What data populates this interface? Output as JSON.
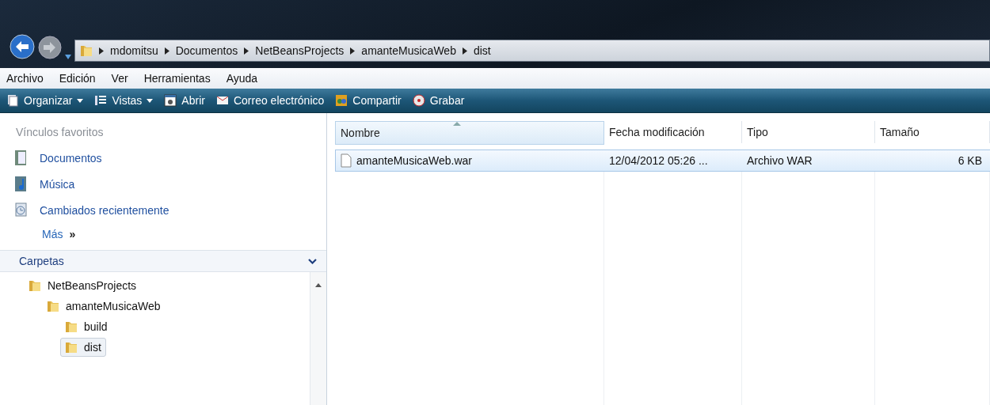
{
  "address_bar": {
    "crumbs": [
      "mdomitsu",
      "Documentos",
      "NetBeansProjects",
      "amanteMusicaWeb",
      "dist"
    ]
  },
  "menu_bar": [
    "Archivo",
    "Edición",
    "Ver",
    "Herramientas",
    "Ayuda"
  ],
  "toolbar": [
    {
      "label": "Organizar",
      "kind": "organize",
      "dropdown": true
    },
    {
      "label": "Vistas",
      "kind": "views",
      "dropdown": true
    },
    {
      "label": "Abrir",
      "kind": "open",
      "dropdown": false
    },
    {
      "label": "Correo electrónico",
      "kind": "mail",
      "dropdown": false
    },
    {
      "label": "Compartir",
      "kind": "share",
      "dropdown": false
    },
    {
      "label": "Grabar",
      "kind": "burn",
      "dropdown": false
    }
  ],
  "sidebar": {
    "title": "Vínculos favoritos",
    "links": [
      {
        "label": "Documentos",
        "kind": "documents"
      },
      {
        "label": "Música",
        "kind": "music"
      },
      {
        "label": "Cambiados recientemente",
        "kind": "recent"
      }
    ],
    "more": {
      "label": "Más",
      "chevrons": "»"
    },
    "folders_title": "Carpetas",
    "tree": [
      {
        "label": "NetBeansProjects",
        "selected": false,
        "children": [
          {
            "label": "amanteMusicaWeb",
            "selected": false,
            "children": [
              {
                "label": "build",
                "selected": false
              },
              {
                "label": "dist",
                "selected": true
              }
            ]
          }
        ]
      }
    ]
  },
  "file_list": {
    "columns": [
      {
        "label": "Nombre",
        "sorted": true
      },
      {
        "label": "Fecha modificación",
        "sorted": false
      },
      {
        "label": "Tipo",
        "sorted": false
      },
      {
        "label": "Tamaño",
        "sorted": false
      }
    ],
    "rows": [
      {
        "cells": [
          "amanteMusicaWeb.war",
          "12/04/2012 05:26 ...",
          "Archivo WAR",
          "6 KB"
        ],
        "selected": true
      }
    ]
  }
}
